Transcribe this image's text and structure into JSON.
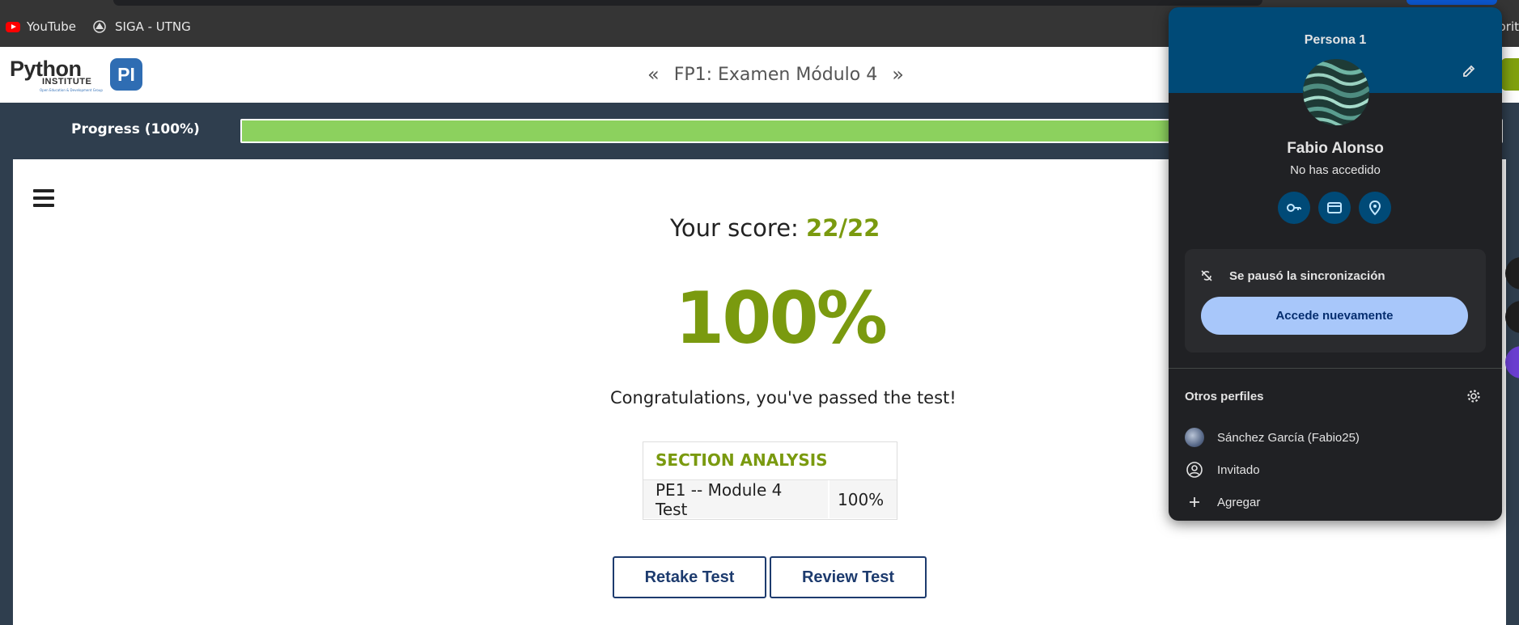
{
  "bookmarks": [
    {
      "label": "YouTube",
      "icon": "youtube-icon"
    },
    {
      "label": "SIGA - UTNG",
      "icon": "siga-icon"
    }
  ],
  "bookmarks_right_partial": "orit",
  "site": {
    "logo_main": "Python",
    "logo_sub": "INSTITUTE",
    "logo_tagline": "Open Education & Development Group",
    "logo_badge": "PI",
    "prev_arrow": "«",
    "next_arrow": "»",
    "page_title": "FP1: Examen Módulo 4"
  },
  "progress": {
    "label": "Progress (100%)",
    "value": 100,
    "fill_color": "#8cd15e"
  },
  "result": {
    "score_label": "Your score:",
    "score_value": "22/22",
    "percent": "100%",
    "message": "Congratulations, you've passed the test!",
    "accent_color": "#7a9a0f"
  },
  "analysis": {
    "heading": "SECTION ANALYSIS",
    "rows": [
      {
        "name": "PE1 -- Module 4 Test",
        "value": "100%"
      }
    ]
  },
  "buttons": {
    "retake": "Retake Test",
    "review": "Review Test"
  },
  "profile_popup": {
    "title": "Persona 1",
    "name": "Fabio Alonso",
    "status": "No has accedido",
    "quick_icons": [
      "key-icon",
      "credit-card-icon",
      "location-pin-icon"
    ],
    "sync_message": "Se pausó la sincronización",
    "sync_button": "Accede nuevamente",
    "others_title": "Otros perfiles",
    "profiles": [
      {
        "label": "Sánchez García (Fabio25)",
        "icon": "profile-avatar"
      },
      {
        "label": "Invitado",
        "icon": "guest-icon"
      },
      {
        "label": "Agregar",
        "icon": "plus-icon"
      }
    ],
    "band_color": "#004a77"
  }
}
